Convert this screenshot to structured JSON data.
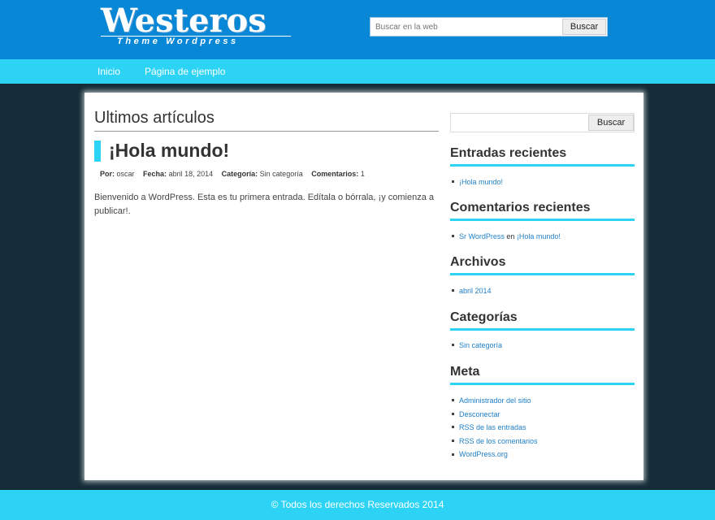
{
  "header": {
    "logo_text": "Westeros",
    "logo_subtitle": "Theme Wordpress",
    "search_placeholder": "Buscar en la web",
    "search_button": "Buscar"
  },
  "nav": {
    "items": [
      {
        "label": "Inicio"
      },
      {
        "label": "Página de ejemplo"
      }
    ]
  },
  "main": {
    "section_title": "Ultimos artículos",
    "post": {
      "title": "¡Hola mundo!",
      "meta": {
        "author_label": "Por:",
        "author": "oscar",
        "date_label": "Fecha:",
        "date": "abril 18, 2014",
        "category_label": "Categoría:",
        "category": "Sin categoría",
        "comments_label": "Comentarios:",
        "comments": "1"
      },
      "body": "Bienvenido a WordPress. Esta es tu primera entrada. Edítala o bórrala, ¡y comienza a publicar!."
    }
  },
  "sidebar": {
    "search_button": "Buscar",
    "widgets": [
      {
        "title": "Entradas recientes",
        "items": [
          {
            "link": "¡Hola mundo!"
          }
        ]
      },
      {
        "title": "Comentarios recientes",
        "items": [
          {
            "link": "Sr WordPress",
            "text": " en ",
            "link2": "¡Hola mundo!"
          }
        ]
      },
      {
        "title": "Archivos",
        "items": [
          {
            "link": "abril 2014"
          }
        ]
      },
      {
        "title": "Categorías",
        "items": [
          {
            "link": "Sin categoría"
          }
        ]
      },
      {
        "title": "Meta",
        "items": [
          {
            "link": "Administrador del sitio"
          },
          {
            "link": "Desconectar"
          },
          {
            "link": "RSS de las entradas"
          },
          {
            "link": "RSS de los comentarios"
          },
          {
            "link": "WordPress.org"
          }
        ]
      }
    ]
  },
  "footer": {
    "text": "© Todos los derechos Reservados 2014"
  },
  "colors": {
    "header_blue": "#0787d6",
    "accent_cyan": "#2dd3f5",
    "background_dark": "#152c38",
    "link_blue": "#1e7fc8"
  }
}
